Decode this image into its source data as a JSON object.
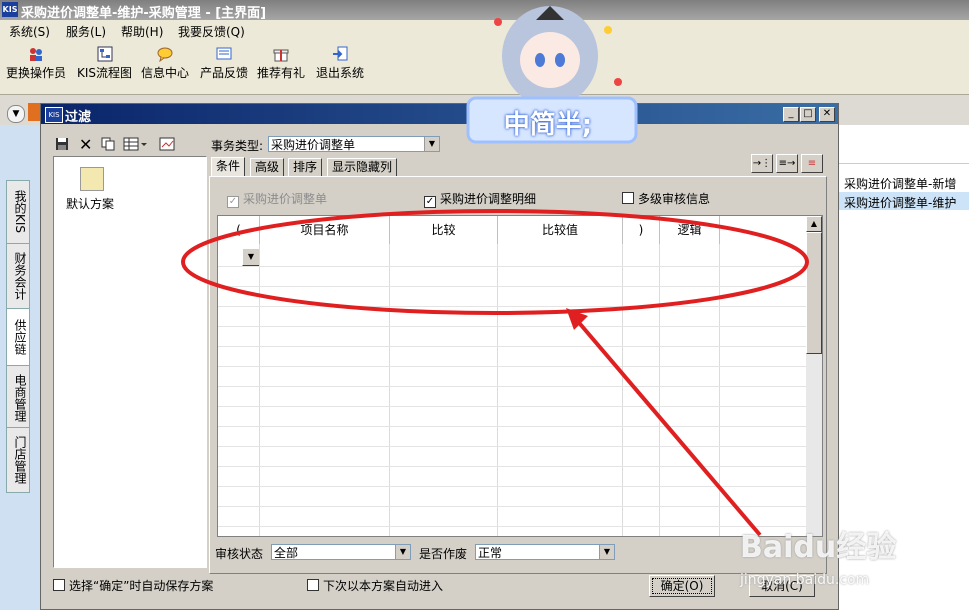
{
  "app": {
    "title": "采购进价调整单-维护-采购管理 - [主界面]",
    "logo": "KIS"
  },
  "menu": [
    "系统(S)",
    "服务(L)",
    "帮助(H)",
    "我要反馈(Q)"
  ],
  "toolbar": [
    {
      "label": "更换操作员",
      "icon": "users-icon"
    },
    {
      "label": "KIS流程图",
      "icon": "flowchart-icon"
    },
    {
      "label": "信息中心",
      "icon": "message-icon"
    },
    {
      "label": "产品反馈",
      "icon": "feedback-icon"
    },
    {
      "label": "推荐有礼",
      "icon": "gift-icon"
    },
    {
      "label": "退出系统",
      "icon": "exit-icon"
    }
  ],
  "sidebar": [
    "我的KIS",
    "财务会计",
    "供应链",
    "电商管理",
    "门店管理"
  ],
  "right_panel": [
    "采购进价调整单-新增",
    "采购进价调整单-维护"
  ],
  "overlay_banner": "中简半;",
  "dialog": {
    "title": "过滤",
    "logo": "KIS",
    "scheme": "默认方案",
    "business_type_label": "事务类型:",
    "business_type_value": "采购进价调整单",
    "tabs": [
      "条件",
      "高级",
      "排序",
      "显示隐藏列"
    ],
    "checks": [
      {
        "label": "采购进价调整单",
        "checked": true,
        "disabled": true
      },
      {
        "label": "采购进价调整明细",
        "checked": true,
        "disabled": false
      },
      {
        "label": "多级审核信息",
        "checked": false,
        "disabled": false
      }
    ],
    "columns": [
      "(",
      "项目名称",
      "比较",
      "比较值",
      ")",
      "逻辑"
    ],
    "audit_label": "审核状态",
    "audit_value": "全部",
    "void_label": "是否作废",
    "void_value": "正常",
    "auto_save": "选择“确定”时自动保存方案",
    "auto_enter": "下次以本方案自动进入",
    "ok": "确定(O)",
    "cancel": "取消(C)"
  },
  "watermark": {
    "brand": "Baidu经验",
    "url": "jingyan.baidu.com"
  },
  "colors": {
    "annotation": "#e02020",
    "dialog_title": "#0a246a"
  }
}
